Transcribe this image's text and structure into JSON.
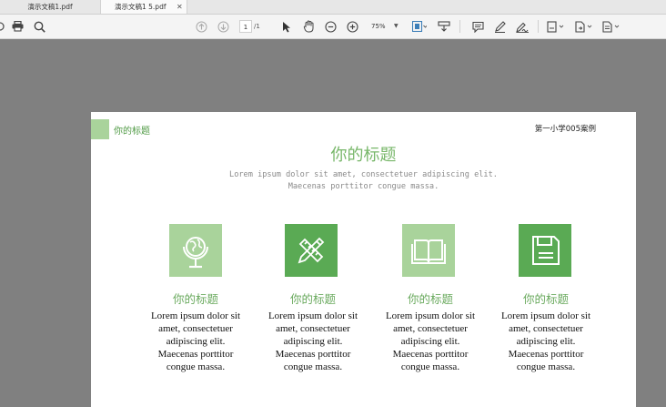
{
  "tabs": [
    {
      "label": "演示文稿1.pdf"
    },
    {
      "label": "演示文稿1 5.pdf"
    }
  ],
  "toolbar": {
    "page_current": "1",
    "page_total": "/1",
    "zoom": "75%"
  },
  "document": {
    "header_title": "你的标题",
    "header_right": "第一小学005案例",
    "main_title": "你的标题",
    "subtitle_line1": "Lorem ipsum dolor sit amet, consectetuer adipiscing elit.",
    "subtitle_line2": "Maecenas porttitor congue massa.",
    "features": [
      {
        "icon": "globe-icon",
        "color": "#a9d39b",
        "title": "你的标题",
        "text_l1": "Lorem ipsum dolor sit",
        "text_l2": "amet, consectetuer",
        "text_l3": "adipiscing elit.",
        "text_l4": "Maecenas porttitor",
        "text_l5": "congue massa."
      },
      {
        "icon": "pencil-ruler-icon",
        "color": "#5aaa54",
        "title": "你的标题",
        "text_l1": "Lorem ipsum dolor sit",
        "text_l2": "amet, consectetuer",
        "text_l3": "adipiscing elit.",
        "text_l4": "Maecenas porttitor",
        "text_l5": "congue massa."
      },
      {
        "icon": "book-icon",
        "color": "#a9d39b",
        "title": "你的标题",
        "text_l1": "Lorem ipsum dolor sit",
        "text_l2": "amet, consectetuer",
        "text_l3": "adipiscing elit.",
        "text_l4": "Maecenas porttitor",
        "text_l5": "congue massa."
      },
      {
        "icon": "floppy-disk-icon",
        "color": "#5aaa54",
        "title": "你的标题",
        "text_l1": "Lorem ipsum dolor sit",
        "text_l2": "amet, consectetuer",
        "text_l3": "adipiscing elit.",
        "text_l4": "Maecenas porttitor",
        "text_l5": "congue massa."
      }
    ]
  }
}
